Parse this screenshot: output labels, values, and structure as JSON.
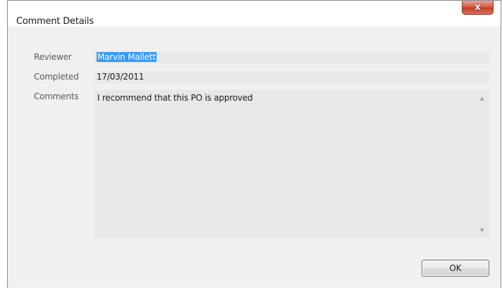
{
  "window": {
    "title": "Comment Details",
    "close_glyph": "x"
  },
  "form": {
    "reviewer_label": "Reviewer",
    "reviewer_value": "Marvin Mallett",
    "completed_label": "Completed",
    "completed_value": "17/03/2011",
    "comments_label": "Comments",
    "comments_value": "I recommend that this PO is approved"
  },
  "buttons": {
    "ok_label": "OK"
  },
  "icons": {
    "close": "close-icon",
    "scroll_up": "scroll-up-arrow-icon",
    "scroll_down": "scroll-down-arrow-icon"
  },
  "colors": {
    "selection": "#3399ff",
    "close_button": "#c43b24",
    "field_background": "#e8e8e8",
    "window_background": "#f0f0f0"
  }
}
